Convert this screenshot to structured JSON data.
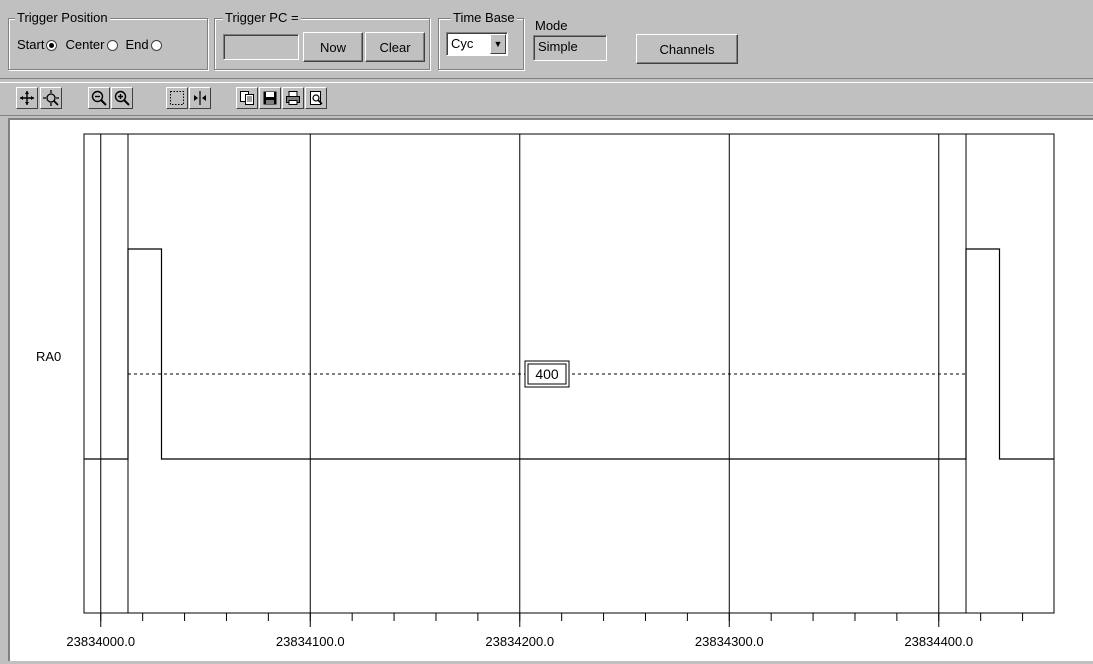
{
  "trigger_position": {
    "legend": "Trigger Position",
    "options": [
      {
        "label": "Start",
        "selected": true
      },
      {
        "label": "Center",
        "selected": false
      },
      {
        "label": "End",
        "selected": false
      }
    ]
  },
  "trigger_pc": {
    "legend": "Trigger PC =",
    "value": "",
    "now_label": "Now",
    "clear_label": "Clear"
  },
  "time_base": {
    "legend": "Time Base",
    "selected": "Cyc"
  },
  "mode": {
    "label": "Mode",
    "value": "Simple"
  },
  "channels_label": "Channels",
  "toolbar": {
    "icons": [
      "cursor-crosshair-icon",
      "zoom-fit-icon",
      "zoom-out-icon",
      "zoom-in-icon",
      "select-region-icon",
      "marker-icon",
      "copy-icon",
      "save-icon",
      "print-icon",
      "print-preview-icon"
    ]
  },
  "chart_data": {
    "type": "line",
    "channel_label": "RA0",
    "measurement_label": "400",
    "x_tick_labels": [
      "23834000.0",
      "23834100.0",
      "23834200.0",
      "23834300.0",
      "23834400.0"
    ],
    "x_major_ticks": [
      23834000,
      23834100,
      23834200,
      23834300,
      23834400
    ],
    "xlim": [
      23833992,
      23834455
    ],
    "signal": {
      "name": "RA0",
      "x": [
        23833992,
        23834013,
        23834013,
        23834029,
        23834029,
        23834413,
        23834413,
        23834429,
        23834429,
        23834455
      ],
      "y": [
        0,
        0,
        1,
        1,
        0,
        0,
        1,
        1,
        0,
        0
      ]
    },
    "cursor_lines": [
      23834000,
      23834013,
      23834100,
      23834200,
      23834300,
      23834400,
      23834413
    ],
    "measurement_span": [
      23834013,
      23834413
    ]
  }
}
